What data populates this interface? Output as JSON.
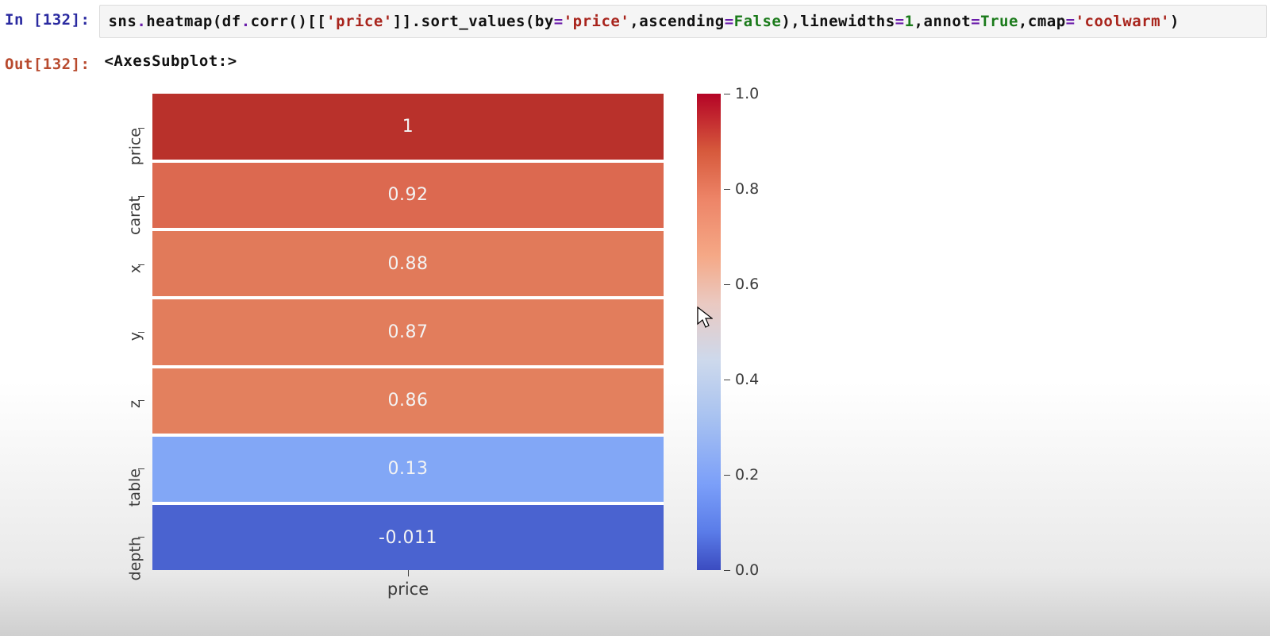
{
  "cell": {
    "exec_count": 132,
    "in_prompt_prefix": "In [",
    "in_prompt_suffix": "]:",
    "out_prompt_prefix": "Out[",
    "out_prompt_suffix": "]:",
    "output_repr": "<AxesSubplot:>",
    "code_tokens": [
      {
        "t": "sns",
        "c": "tok-id"
      },
      {
        "t": ".",
        "c": "tok-op"
      },
      {
        "t": "heatmap",
        "c": "tok-id"
      },
      {
        "t": "(",
        "c": "tok-id"
      },
      {
        "t": "df",
        "c": "tok-id"
      },
      {
        "t": ".",
        "c": "tok-op"
      },
      {
        "t": "corr",
        "c": "tok-id"
      },
      {
        "t": "()[[",
        "c": "tok-id"
      },
      {
        "t": "'price'",
        "c": "tok-str"
      },
      {
        "t": "]].",
        "c": "tok-id"
      },
      {
        "t": "sort_values",
        "c": "tok-id"
      },
      {
        "t": "(",
        "c": "tok-id"
      },
      {
        "t": "by",
        "c": "tok-id"
      },
      {
        "t": "=",
        "c": "tok-op"
      },
      {
        "t": "'price'",
        "c": "tok-str"
      },
      {
        "t": ",",
        "c": "tok-id"
      },
      {
        "t": "ascending",
        "c": "tok-id"
      },
      {
        "t": "=",
        "c": "tok-op"
      },
      {
        "t": "False",
        "c": "tok-bool"
      },
      {
        "t": "),",
        "c": "tok-id"
      },
      {
        "t": "linewidths",
        "c": "tok-id"
      },
      {
        "t": "=",
        "c": "tok-op"
      },
      {
        "t": "1",
        "c": "tok-num"
      },
      {
        "t": ",",
        "c": "tok-id"
      },
      {
        "t": "annot",
        "c": "tok-id"
      },
      {
        "t": "=",
        "c": "tok-op"
      },
      {
        "t": "True",
        "c": "tok-bool"
      },
      {
        "t": ",",
        "c": "tok-id"
      },
      {
        "t": "cmap",
        "c": "tok-id"
      },
      {
        "t": "=",
        "c": "tok-op"
      },
      {
        "t": "'coolwarm'",
        "c": "tok-str"
      },
      {
        "t": ")",
        "c": "tok-id"
      }
    ]
  },
  "chart_data": {
    "type": "heatmap",
    "categories": [
      "price",
      "carat",
      "x",
      "y",
      "z",
      "table",
      "depth"
    ],
    "values": [
      1,
      0.92,
      0.88,
      0.87,
      0.86,
      0.13,
      -0.011
    ],
    "annotations": [
      "1",
      "0.92",
      "0.88",
      "0.87",
      "0.86",
      "0.13",
      "-0.011"
    ],
    "colors": [
      "#b9312b",
      "#dc6950",
      "#e17a5a",
      "#e27d5c",
      "#e3805e",
      "#82a7f6",
      "#4a63d0"
    ],
    "xlabel": "price",
    "ylabel": "",
    "colorbar": {
      "ticks": [
        1.0,
        0.8,
        0.6,
        0.4,
        0.2,
        0.0
      ],
      "positions": [
        0,
        20,
        40,
        60,
        80,
        100
      ],
      "labels": [
        "1.0",
        "0.8",
        "0.6",
        "0.4",
        "0.2",
        "0.0"
      ]
    }
  }
}
